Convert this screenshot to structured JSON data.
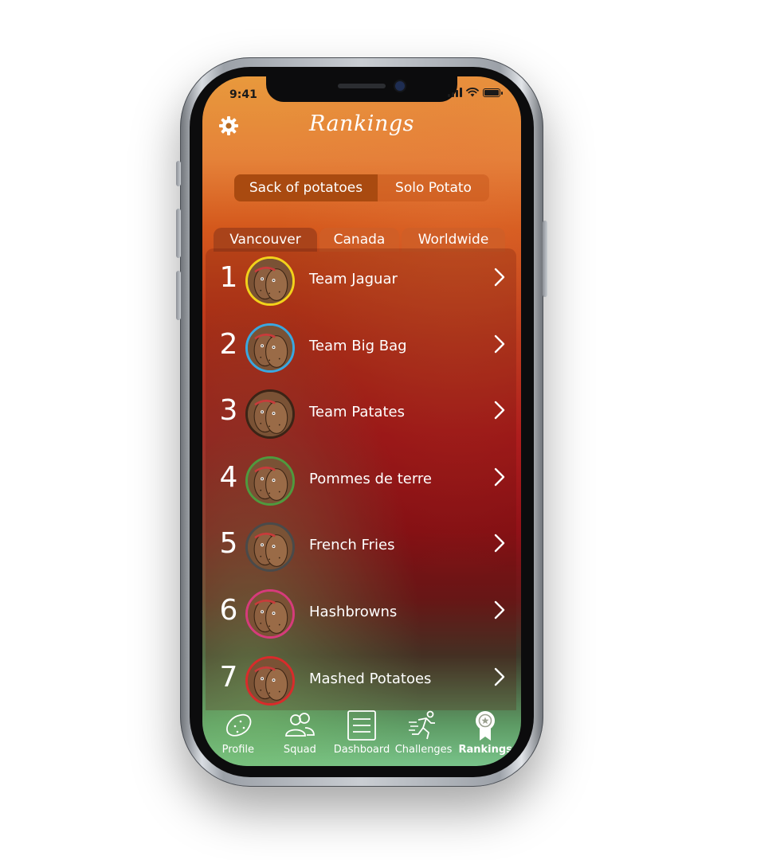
{
  "status_bar": {
    "time": "9:41"
  },
  "header": {
    "title": "Rankings"
  },
  "segment": {
    "options": [
      {
        "label": "Sack of potatoes",
        "selected": true
      },
      {
        "label": "Solo Potato",
        "selected": false
      }
    ]
  },
  "region_tabs": [
    {
      "label": "Vancouver",
      "selected": true
    },
    {
      "label": "Canada",
      "selected": false
    },
    {
      "label": "Worldwide",
      "selected": false
    }
  ],
  "rankings": [
    {
      "rank": "1",
      "name": "Team Jaguar",
      "ring_color": "#f2d21b"
    },
    {
      "rank": "2",
      "name": "Team Big Bag",
      "ring_color": "#3aa7e0"
    },
    {
      "rank": "3",
      "name": "Team Patates",
      "ring_color": "#3b2416"
    },
    {
      "rank": "4",
      "name": "Pommes de terre",
      "ring_color": "#4f9a3e"
    },
    {
      "rank": "5",
      "name": "French Fries",
      "ring_color": "#4a4a4a"
    },
    {
      "rank": "6",
      "name": "Hashbrowns",
      "ring_color": "#d63b7b"
    },
    {
      "rank": "7",
      "name": "Mashed Potatoes",
      "ring_color": "#d92b2b"
    }
  ],
  "tab_bar": [
    {
      "label": "Profile",
      "icon": "potato-icon",
      "active": false
    },
    {
      "label": "Squad",
      "icon": "squad-icon",
      "active": false
    },
    {
      "label": "Dashboard",
      "icon": "dashboard-icon",
      "active": false
    },
    {
      "label": "Challenges",
      "icon": "runner-icon",
      "active": false
    },
    {
      "label": "Rankings",
      "icon": "medal-icon",
      "active": true
    }
  ]
}
